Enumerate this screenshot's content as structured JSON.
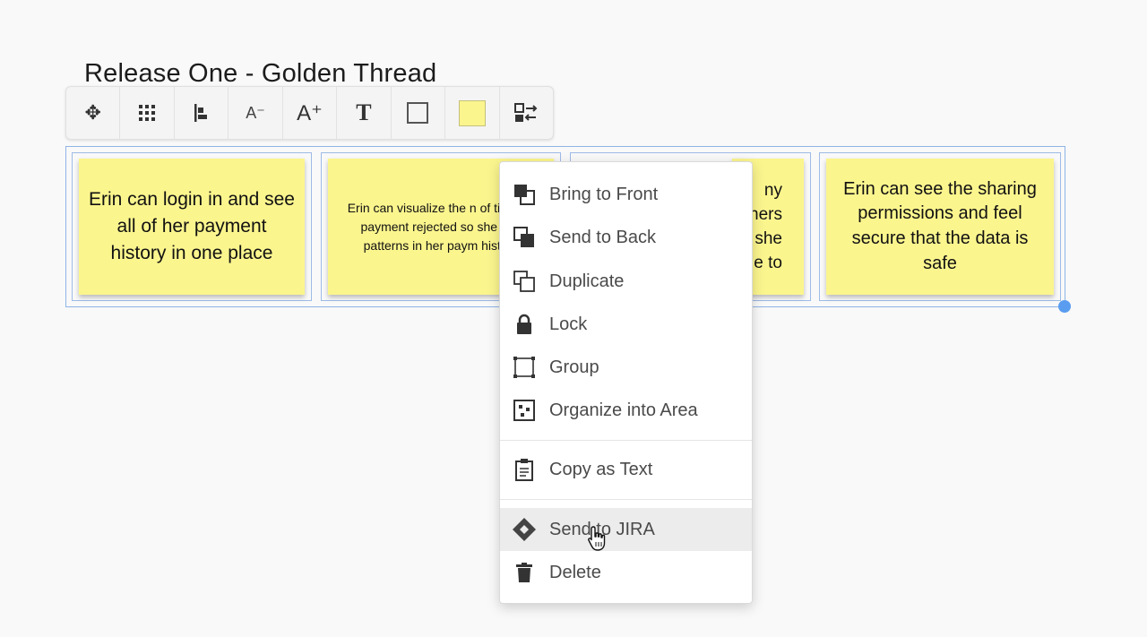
{
  "board": {
    "title": "Release One - Golden Thread"
  },
  "toolbar": {
    "buttons": [
      {
        "icon": "move-icon",
        "glyph": "✥"
      },
      {
        "icon": "grid-icon",
        "glyph": ""
      },
      {
        "icon": "align-left-icon",
        "glyph": ""
      },
      {
        "icon": "decrease-font-icon",
        "glyph": "A⁻"
      },
      {
        "icon": "increase-font-icon",
        "glyph": "A⁺"
      },
      {
        "icon": "text-style-icon",
        "glyph": "T"
      },
      {
        "icon": "border-icon",
        "glyph": ""
      },
      {
        "icon": "color-swatch",
        "glyph": ""
      },
      {
        "icon": "swap-icon",
        "glyph": ""
      }
    ],
    "swatch_color": "#fbf58e"
  },
  "stickies": [
    {
      "text": "Erin can login in and see all of her payment history in one place",
      "size": "large"
    },
    {
      "text": "Erin can visualize the n of times a payment rejected so she can patterns in her paym history",
      "size": "small"
    },
    {
      "text": "ny ners she e to",
      "size": "large"
    },
    {
      "text": "Erin can see the sharing permissions and feel secure that the data is safe",
      "size": "large"
    }
  ],
  "context_menu": {
    "items": [
      {
        "label": "Bring to Front",
        "icon": "bring-to-front-icon"
      },
      {
        "label": "Send to Back",
        "icon": "send-to-back-icon"
      },
      {
        "label": "Duplicate",
        "icon": "duplicate-icon"
      },
      {
        "label": "Lock",
        "icon": "lock-icon"
      },
      {
        "label": "Group",
        "icon": "group-icon"
      },
      {
        "label": "Organize into Area",
        "icon": "organize-area-icon"
      },
      {
        "label": "Copy as Text",
        "icon": "clipboard-icon"
      },
      {
        "label": "Send to JIRA",
        "icon": "jira-icon",
        "hovered": true
      },
      {
        "label": "Delete",
        "icon": "trash-icon"
      }
    ]
  },
  "colors": {
    "sticky": "#fbf58e",
    "selection": "#8fb4e6",
    "handle": "#5a9df0",
    "menu_hover": "#ececec"
  }
}
